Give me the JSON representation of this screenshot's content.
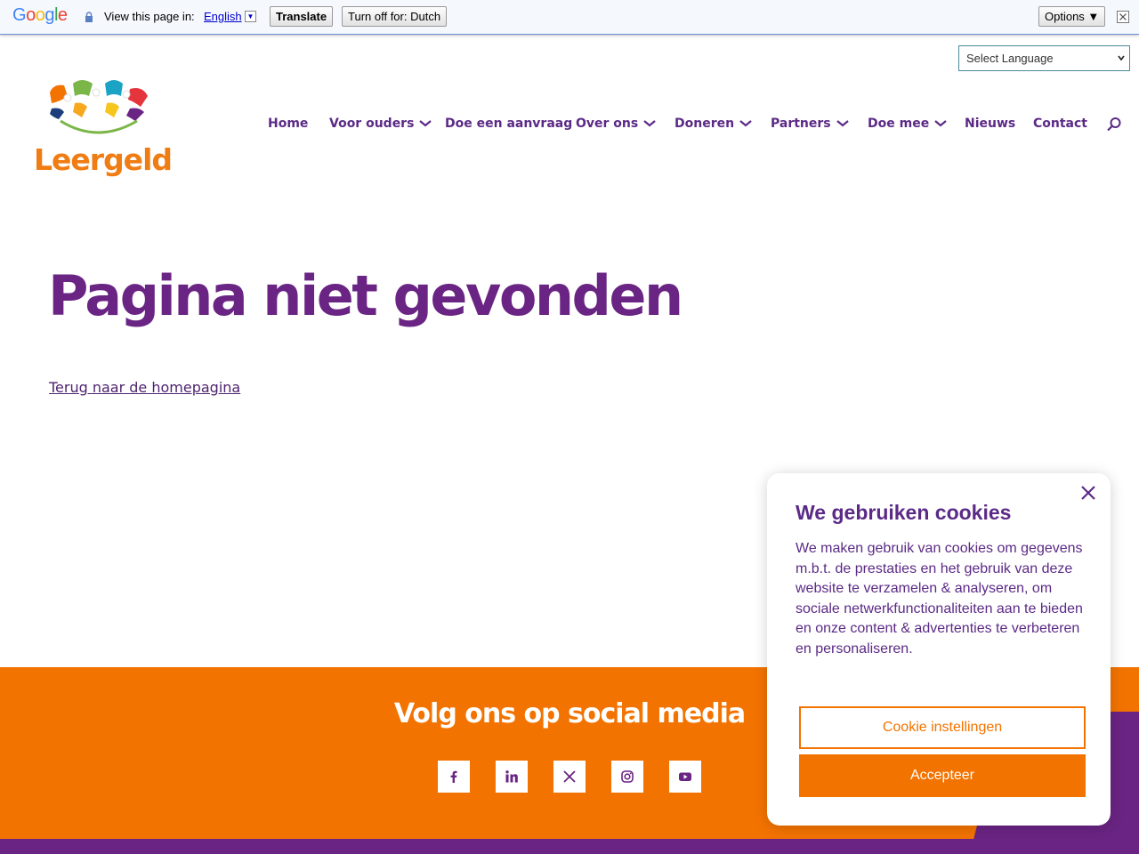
{
  "translate_bar": {
    "logo": [
      "G",
      "o",
      "o",
      "g",
      "l",
      "e"
    ],
    "logo_colors": [
      "#4285f4",
      "#ea4335",
      "#fbbc05",
      "#4285f4",
      "#34a853",
      "#ea4335"
    ],
    "prompt": "View this page in:",
    "language": "English",
    "translate_label": "Translate",
    "turn_off_label": "Turn off for: Dutch",
    "options_label": "Options ▼"
  },
  "language_select": {
    "value": "Select Language"
  },
  "logo": {
    "text": "Leergeld"
  },
  "nav": {
    "items": [
      {
        "label": "Home"
      },
      {
        "label": "Voor ouders"
      },
      {
        "label": "Doe een aanvraag"
      },
      {
        "label": "Over ons"
      },
      {
        "label": "Doneren"
      },
      {
        "label": "Partners"
      },
      {
        "label": "Doe mee"
      },
      {
        "label": "Nieuws"
      },
      {
        "label": "Contact"
      }
    ]
  },
  "main": {
    "title": "Pagina niet gevonden",
    "home_link": "Terug naar de homepagina"
  },
  "footer": {
    "social_title": "Volg ons op social media",
    "socials": [
      "facebook-icon",
      "linkedin-icon",
      "x-icon",
      "instagram-icon",
      "youtube-icon"
    ]
  },
  "cookie": {
    "title": "We gebruiken cookies",
    "body": "We maken gebruik van cookies om gegevens m.b.t. de prestaties en het gebruik van deze website te verzamelen & analyseren, om sociale netwerkfunctionaliteiten aan te bieden en onze content & advertenties te verbeteren en personaliseren.",
    "settings_label": "Cookie instellingen",
    "accept_label": "Accepteer"
  },
  "colors": {
    "brand_purple": "#6a2483",
    "brand_orange": "#f37300",
    "logo_orange": "#f07d14"
  }
}
